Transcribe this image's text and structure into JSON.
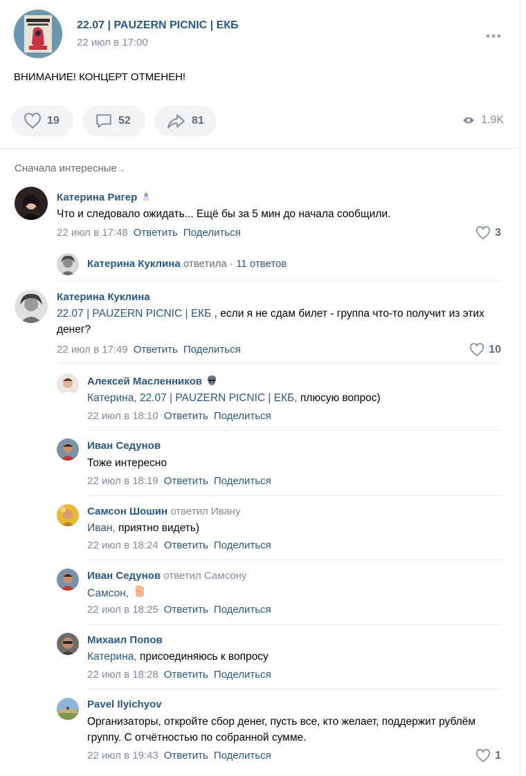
{
  "post": {
    "title": "22.07 | PAUZERN PICNIC | ЕКБ",
    "date": "22 июл в 17:00",
    "text": "ВНИМАНИЕ! КОНЦЕРТ ОТМЕНЕН!",
    "likes": "19",
    "comments": "52",
    "shares": "81",
    "views": "1.9K",
    "menu_icon": "more-horizontal-icon"
  },
  "sort_label": "Сначала интересные",
  "actions": {
    "reply": "Ответить",
    "share": "Поделиться"
  },
  "thread": {
    "name": "Катерина Куклина",
    "verb": "ответила",
    "dot": "·",
    "count": "11 ответов"
  },
  "comments": [
    {
      "name": "Катерина Ригер",
      "badge_icon": "rocket-icon",
      "text": "Что и следовало ожидать... Ещё бы за 5 мин до начала сообщили.",
      "date": "22 июл в 17:48",
      "likes": "3"
    },
    {
      "name": "Катерина Куклина",
      "mention": "22.07 | PAUZERN PICNIC | ЕКБ",
      "text": " , если я не сдам билет - группа что-то получит из этих денег?",
      "date": "22 июл в 17:49",
      "likes": "10"
    }
  ],
  "replies": [
    {
      "name": "Алексей Масленников",
      "badge_icon": "alien-icon",
      "mention": "Катерина, 22.07 | PAUZERN PICNIC | ЕКБ,",
      "text": " плюсую вопрос)",
      "date": "22 июл в 18:10"
    },
    {
      "name": "Иван Седунов",
      "text": "Тоже интересно",
      "date": "22 июл в 18:19"
    },
    {
      "name": "Самсон Шошин",
      "replied": "ответил Ивану",
      "mention": "Иван,",
      "text": " приятно видеть)",
      "date": "22 июл в 18:24"
    },
    {
      "name": "Иван Седунов",
      "replied": "ответил Самсону",
      "mention": "Самсон,",
      "emoji_icon": "raised-fist-icon",
      "date": "22 июл в 18:25"
    },
    {
      "name": "Михаил Попов",
      "mention": "Катерина,",
      "text": " присоединяюсь к вопросу",
      "date": "22 июл в 18:28"
    },
    {
      "name": "Pavel Ilyichyov",
      "text": "Организаторы, откройте сбор денег, пусть все, кто желает, поддержит рублём группу. С отчётностью по собранной сумме.",
      "date": "22 июл в 19:43",
      "likes": "1"
    }
  ],
  "colors": {
    "link": "#2a5885",
    "muted": "#818c99",
    "pill_bg": "#f2f3f5",
    "divider": "#e7e8ec"
  }
}
